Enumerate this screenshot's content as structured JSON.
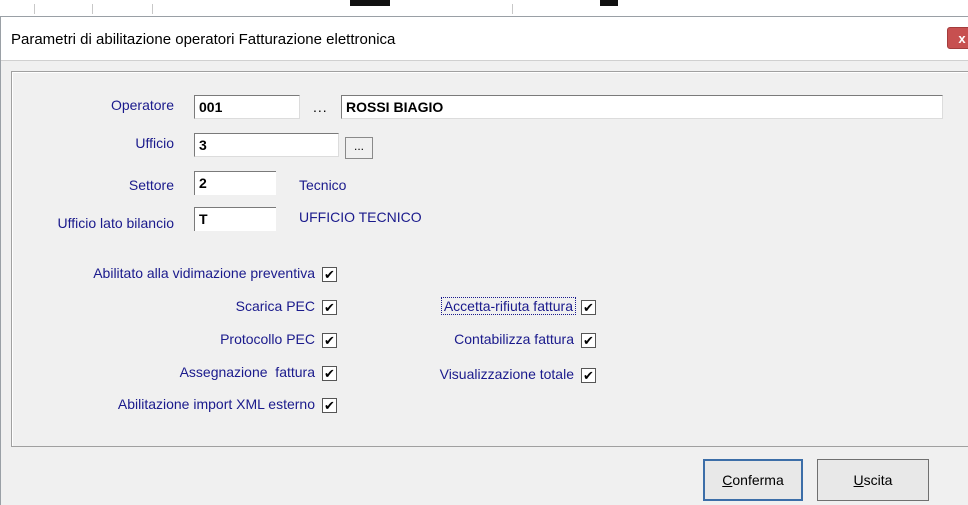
{
  "window": {
    "title": "Parametri di abilitazione operatori Fatturazione elettronica",
    "close_glyph": "x"
  },
  "operatore": {
    "label": "Operatore",
    "code": "001",
    "lookup": "...",
    "name": "ROSSI BIAGIO"
  },
  "ufficio": {
    "label": "Ufficio",
    "value": "3",
    "lookup": "..."
  },
  "settore": {
    "label": "Settore",
    "value": "2",
    "desc": "Tecnico"
  },
  "ufficio_lato_bilancio": {
    "label": "Ufficio lato bilancio",
    "value": "T",
    "desc": "UFFICIO TECNICO"
  },
  "checks_left": [
    {
      "label": "Abilitato alla vidimazione preventiva",
      "checked": true
    },
    {
      "label": "Scarica PEC",
      "checked": true
    },
    {
      "label": "Protocollo PEC",
      "checked": true
    },
    {
      "label": "Assegnazione  fattura",
      "checked": true
    },
    {
      "label": "Abilitazione import XML esterno",
      "checked": true
    }
  ],
  "checks_right": [
    {
      "label": "Accetta-rifiuta fattura",
      "checked": true
    },
    {
      "label": "Contabilizza fattura",
      "checked": true
    },
    {
      "label": "Visualizzazione totale",
      "checked": true
    }
  ],
  "check_glyph": "✔",
  "buttons": {
    "confirm": {
      "first": "C",
      "rest": "onferma"
    },
    "exit": {
      "first": "U",
      "rest": "scita"
    }
  },
  "colors": {
    "label": "#1a1a8c",
    "close": "#c75050",
    "default_button_border": "#3c6ea8"
  }
}
